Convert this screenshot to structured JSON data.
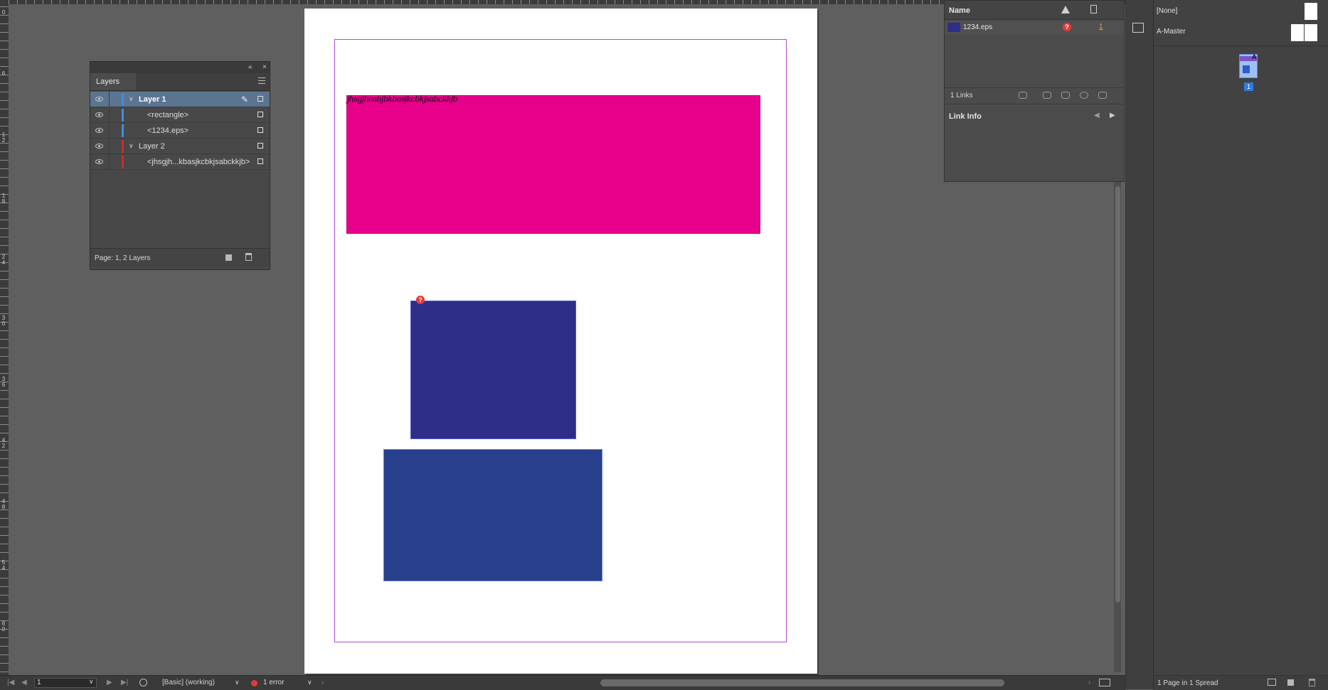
{
  "rulers": {
    "left_numbers": [
      "0",
      "6",
      "1 2",
      "1 8",
      "2 4",
      "3 0",
      "3 6",
      "4 2",
      "4 8",
      "5 4",
      "6 0"
    ]
  },
  "document": {
    "text_frame_content": "jhsgjhcabjbkbasjkcbkjsabckkjb",
    "colors": {
      "pink": "#e6008a",
      "eps": "#2f2d8a",
      "blue": "#283f8c",
      "margin": "#b04ad8"
    },
    "eps_status": "?"
  },
  "layers_panel": {
    "tab_label": "Layers",
    "rows": [
      {
        "label": "Layer 1",
        "bold": true,
        "strip": "#3f8de6"
      },
      {
        "label": "<rectangle>",
        "strip": "#3f8de6"
      },
      {
        "label": "<1234.eps>",
        "strip": "#3f8de6"
      },
      {
        "label": "Layer 2",
        "strip": "#d22a2a"
      },
      {
        "label": "<jhsgjh...kbasjkcbkjsabckkjb>",
        "strip": "#d22a2a"
      }
    ],
    "footer": "Page: 1, 2 Layers",
    "collapse_icon": "«",
    "close_icon": "×",
    "pencil_icon": "✎"
  },
  "links_panel": {
    "header_name": "Name",
    "row": {
      "file": "1234.eps",
      "status": "?",
      "page": "1"
    },
    "count": "1 Links",
    "link_info": "Link Info",
    "prev": "◀",
    "next": "▶"
  },
  "pages_panel": {
    "none_label": "[None]",
    "master_label": "A-Master",
    "thumb_master_letter": "A",
    "page_number": "1",
    "footer": "1 Page in 1 Spread"
  },
  "statusbar": {
    "page_value": "1",
    "preflight_profile": "[Basic] (working)",
    "errors": "1 error"
  }
}
